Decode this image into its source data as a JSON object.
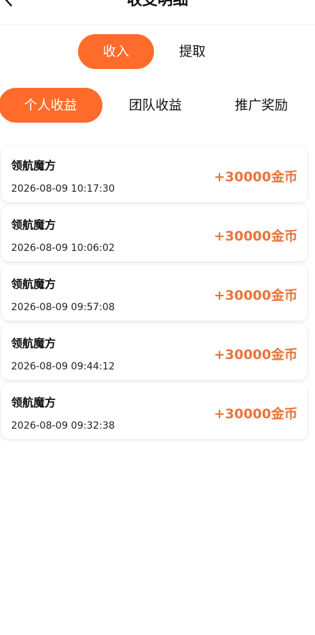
{
  "header": {
    "title": "收支明细",
    "back_icon": "chevron-left-icon"
  },
  "top_tabs": [
    {
      "label": "收入",
      "active": true
    },
    {
      "label": "提取",
      "active": false
    }
  ],
  "sub_tabs": [
    {
      "label": "个人收益",
      "active": true
    },
    {
      "label": "团队收益",
      "active": false
    },
    {
      "label": "推广奖励",
      "active": false
    }
  ],
  "records": [
    {
      "title": "领航魔方",
      "time": "2026-08-09 10:17:30",
      "amount": "+30000金币"
    },
    {
      "title": "领航魔方",
      "time": "2026-08-09 10:06:02",
      "amount": "+30000金币"
    },
    {
      "title": "领航魔方",
      "time": "2026-08-09 09:57:08",
      "amount": "+30000金币"
    },
    {
      "title": "领航魔方",
      "time": "2026-08-09 09:44:12",
      "amount": "+30000金币"
    },
    {
      "title": "领航魔方",
      "time": "2026-08-09 09:32:38",
      "amount": "+30000金币"
    }
  ],
  "colors": {
    "accent": "#ff6b2b",
    "amount": "#e8733a"
  }
}
